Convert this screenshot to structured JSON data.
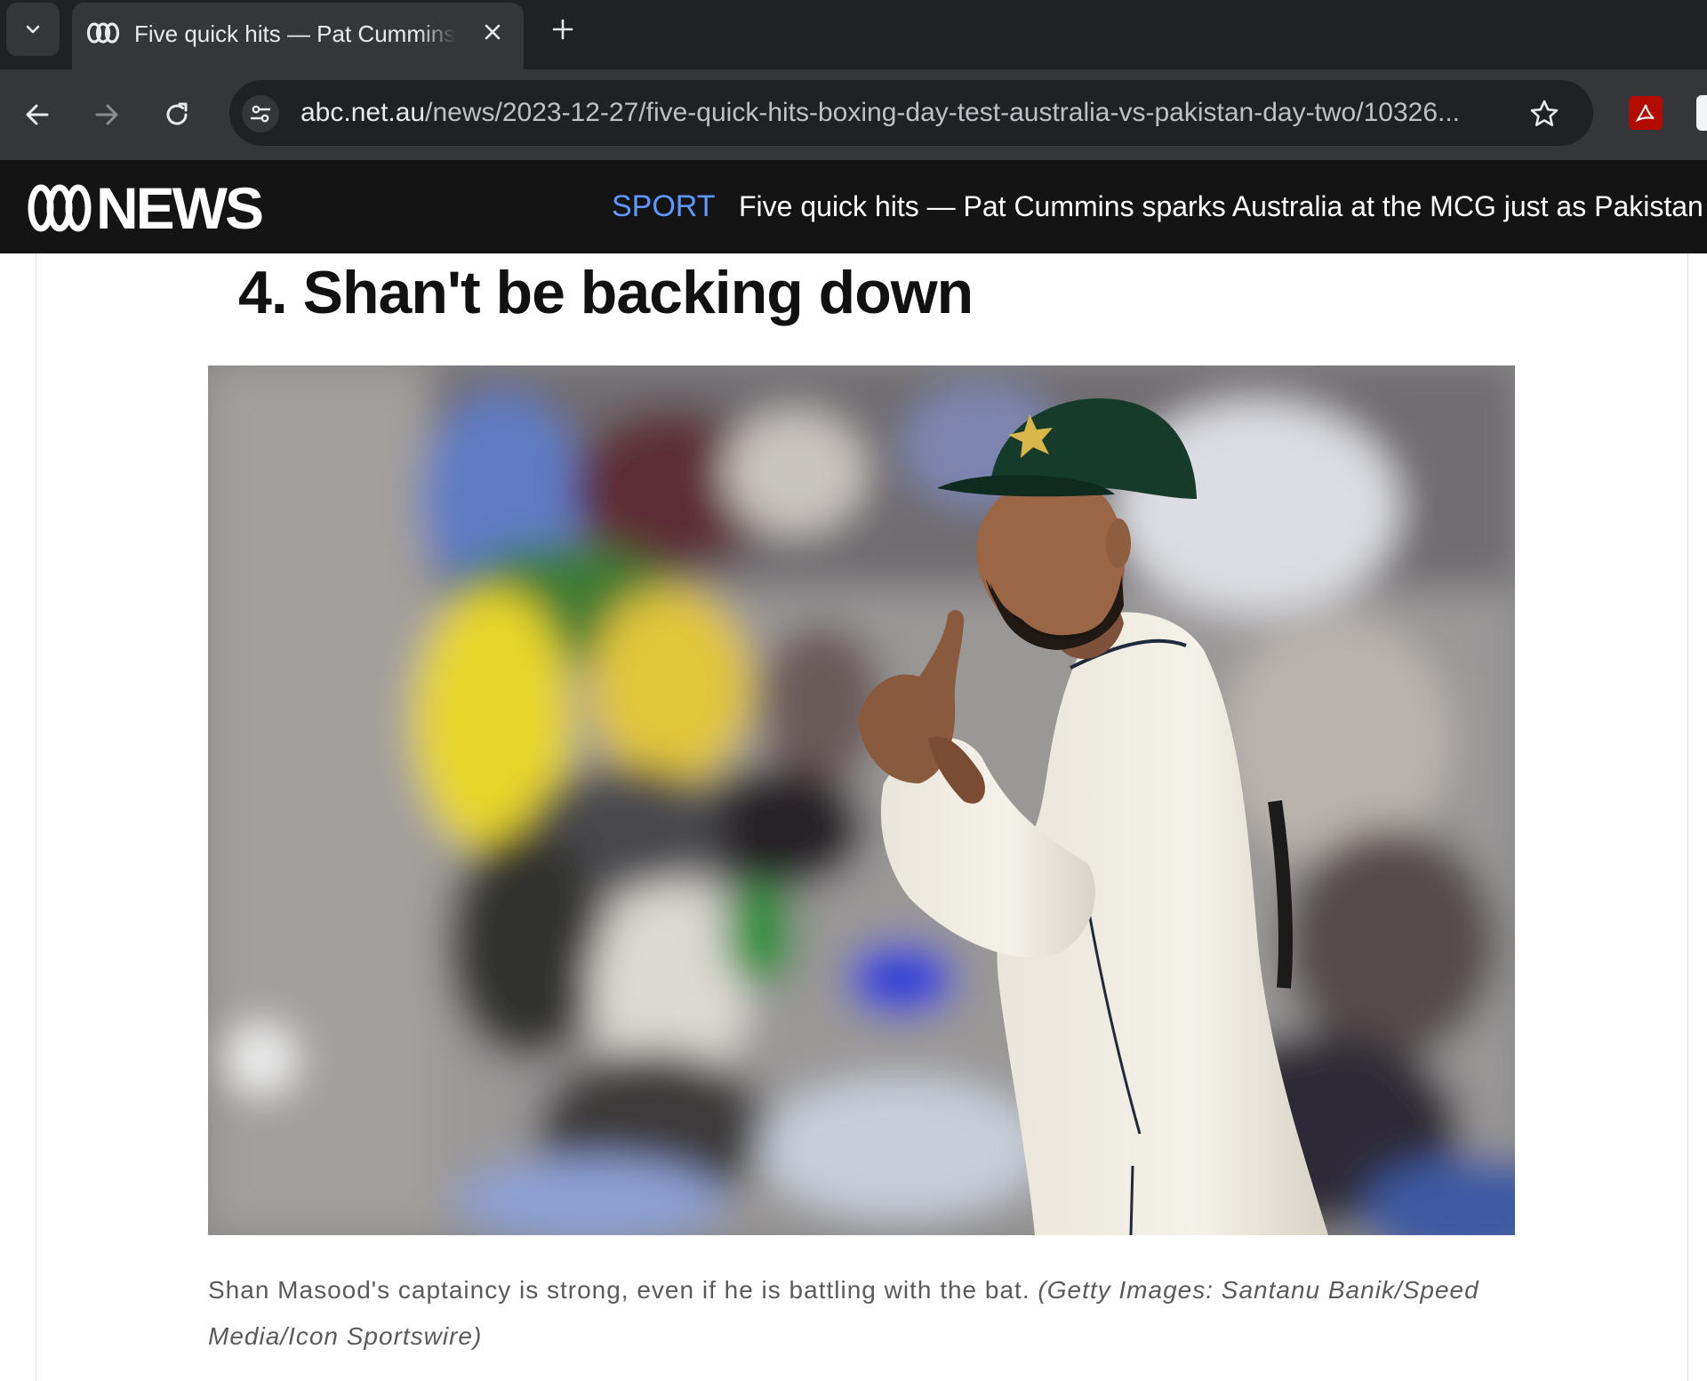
{
  "browser": {
    "tab": {
      "title": "Five quick hits — Pat Cummins sparks Australia at the MCG just as Pakistan",
      "favicon": "abc-logo-icon"
    },
    "toolbar": {
      "url_host": "abc.net.au",
      "url_path": "/news/2023-12-27/five-quick-hits-boxing-day-test-australia-vs-pakistan-day-two/10326..."
    }
  },
  "header": {
    "logo_text": "NEWS",
    "section": "SPORT",
    "title": "Five quick hits — Pat Cummins sparks Australia at the MCG just as Pakistan"
  },
  "article": {
    "heading": "4. Shan't be backing down",
    "image": {
      "description_icon": "photo-cricket-captain"
    },
    "caption": {
      "text": "Shan Masood's captaincy is strong, even if he is battling with the bat.",
      "credit": "(Getty Images: Santanu Banik/Speed Media/Icon Sportswire)"
    }
  },
  "colors": {
    "tabstrip_bg": "#202124",
    "toolbar_bg": "#35363a",
    "abc_header_bg": "#141414",
    "section_accent": "#5f97ff"
  }
}
